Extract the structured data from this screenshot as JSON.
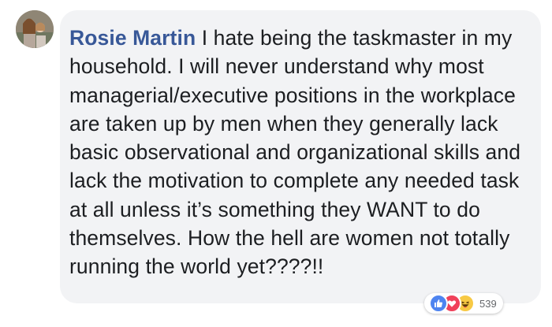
{
  "comment": {
    "author": "Rosie Martin",
    "text": " I hate being the taskmaster in my household. I will never understand why most managerial/executive positions in the workplace are taken up by men when they generally lack basic observational and organizational skills and lack the motivation to complete any needed task at all unless it’s something they WANT to do themselves. How the hell are women not totally running the world yet????!!",
    "reactions": {
      "icons": [
        "like-icon",
        "love-icon",
        "haha-icon"
      ],
      "count": "539"
    }
  },
  "colors": {
    "author": "#385898",
    "bubble": "#f2f3f5",
    "like": "#4e84f0",
    "love": "#f0415a",
    "haha": "#f7c944"
  }
}
